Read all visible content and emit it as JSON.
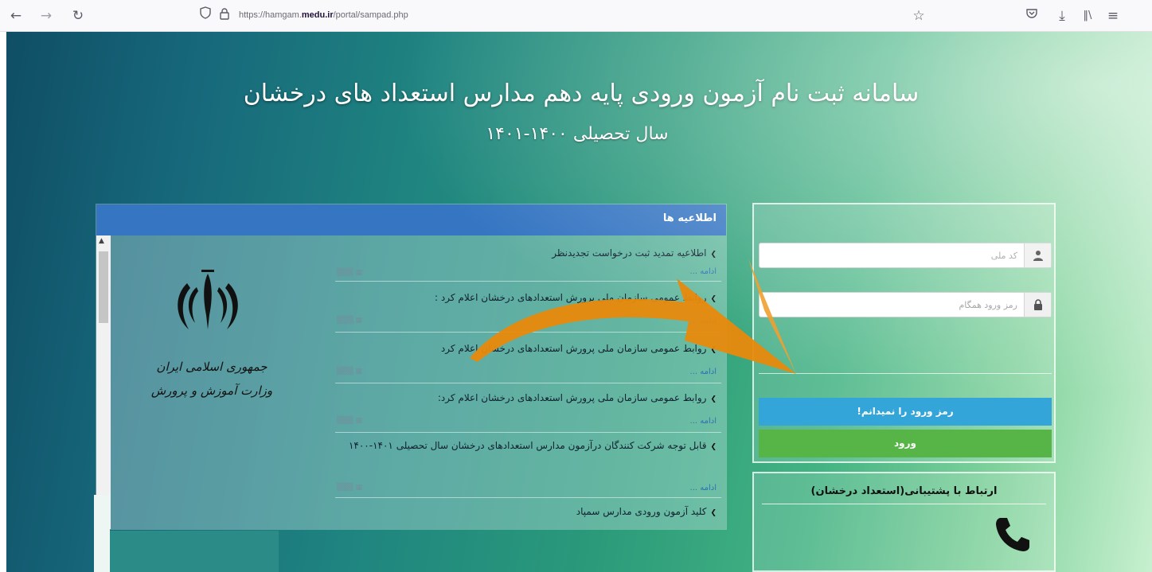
{
  "browser": {
    "url_prefix": "https://hamgam.",
    "url_domain": "medu.ir",
    "url_path": "/portal/sampad.php"
  },
  "page": {
    "title": "سامانه ثبت نام آزمون ورودی پایه دهم مدارس استعداد های درخشان",
    "subtitle": "سال تحصیلی ۱۴۰۰-۱۴۰۱"
  },
  "announcements": {
    "header": "اطلاعیه ها",
    "emblem_line1": "جمهوری اسلامی ایران",
    "emblem_line2": "وزارت آموزش و پرورش",
    "items": [
      {
        "title": "اطلاعیه تمدید ثبت درخواست تجدیدنظر",
        "more": "ادامه ..."
      },
      {
        "title": "روابط عمومی سازمان ملی پرورش استعدادهای درخشان اعلام کرد :",
        "more": "ادامه ..."
      },
      {
        "title": "روابط عمومی سازمان ملی پرورش استعدادهای درخشان اعلام کرد",
        "more": "ادامه ..."
      },
      {
        "title": "روابط عمومی سازمان ملی پرورش استعدادهای درخشان اعلام کرد:",
        "more": "ادامه ..."
      },
      {
        "title": "قابل توجه شرکت کنندگان درآزمون مدارس استعدادهای درخشان سال تحصیلی ۱۴۰۱-۱۴۰۰",
        "more": "ادامه ..."
      },
      {
        "title": "کلید آزمون ورودی مدارس سمپاد",
        "more": ""
      }
    ]
  },
  "login": {
    "national_code_placeholder": "کد ملی",
    "password_placeholder": "رمز ورود همگام",
    "forgot_label": "رمز ورود را نمیدانم!",
    "login_label": "ورود"
  },
  "support": {
    "label": "ارتباط با پشتیبانی(استعداد درخشان)"
  },
  "colors": {
    "header_blue": "#3575c2",
    "forgot_blue": "#34a5d8",
    "login_green": "#57b446",
    "arrow_orange": "#e8890c"
  },
  "icons": [
    "back-icon",
    "forward-icon",
    "reload-icon",
    "shield-icon",
    "lock-icon",
    "bookmark-star-icon",
    "pocket-icon",
    "download-icon",
    "library-icon",
    "menu-icon",
    "user-icon",
    "padlock-icon",
    "phone-icon"
  ]
}
